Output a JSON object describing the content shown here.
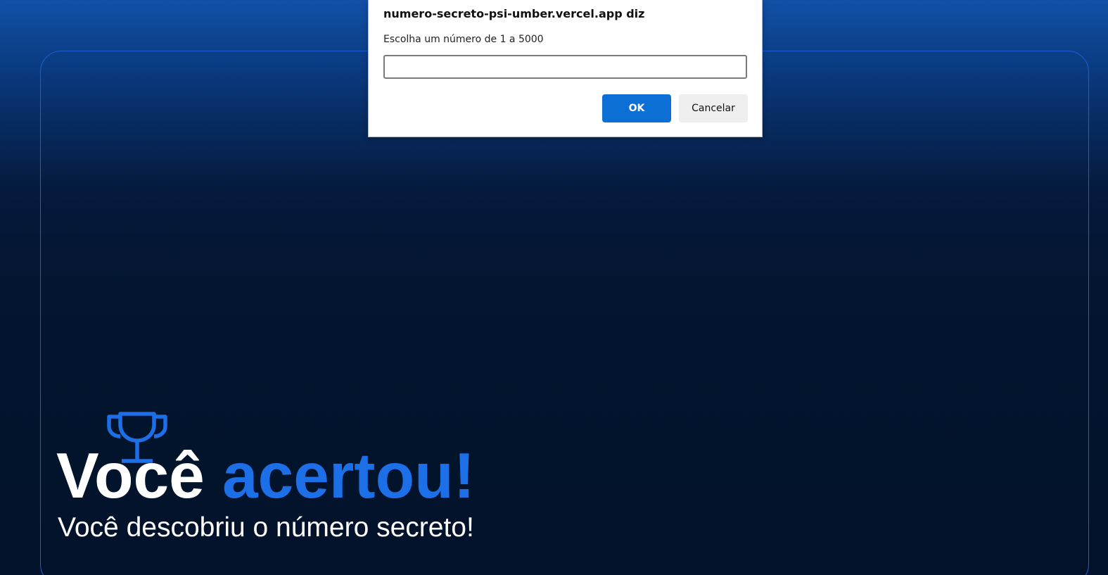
{
  "page": {
    "headline_part1": "Você ",
    "headline_accent": "acertou!",
    "subtitle": "Você descobriu o número secreto!",
    "trophy_icon": "trophy-icon",
    "accent_color": "#1c6fe6",
    "border_color": "#1d5fd1"
  },
  "dialog": {
    "title": "numero-secreto-psi-umber.vercel.app diz",
    "message": "Escolha um número de 1 a 5000",
    "input_value": "",
    "ok_label": "OK",
    "cancel_label": "Cancelar",
    "ok_color": "#0b6fd6"
  }
}
